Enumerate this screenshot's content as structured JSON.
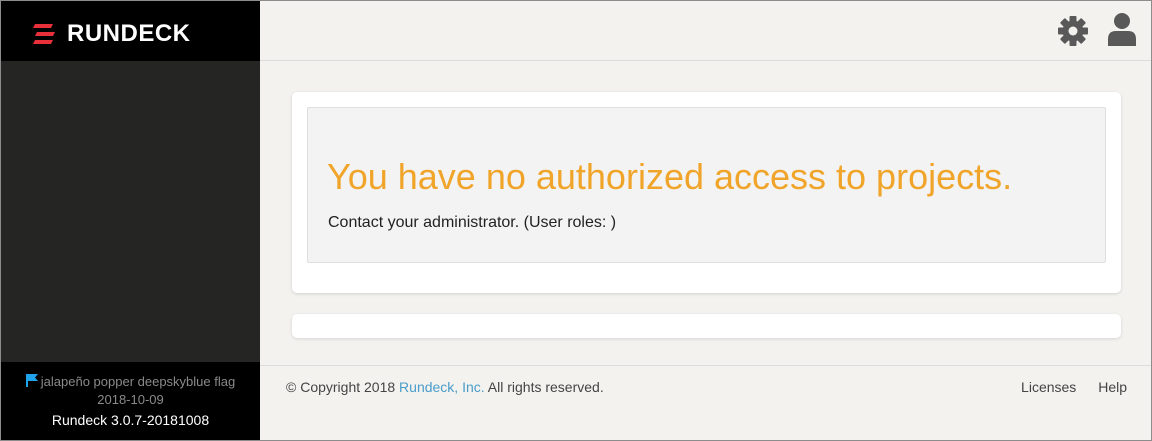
{
  "brand": {
    "name": "RUNDECK"
  },
  "sidebar": {
    "release_name": "jalapeño popper deepskyblue flag",
    "release_date": "2018-10-09",
    "version": "Rundeck 3.0.7-20181008",
    "flag_color": "#1fa3ec"
  },
  "topbar": {
    "icons": [
      "gear-icon",
      "user-icon"
    ]
  },
  "alert": {
    "title": "You have no authorized access to projects.",
    "message": "Contact your administrator. (User roles: )",
    "title_color": "#f0a52a"
  },
  "footer": {
    "copyright_prefix": "© Copyright 2018 ",
    "company_link": "Rundeck, Inc.",
    "copyright_suffix": " All rights reserved.",
    "licenses": "Licenses",
    "help": "Help"
  },
  "colors": {
    "sidebar_bg": "#252523",
    "brand_bg": "#000000",
    "page_bg": "#f3f2ef",
    "link": "#4a9dca"
  }
}
